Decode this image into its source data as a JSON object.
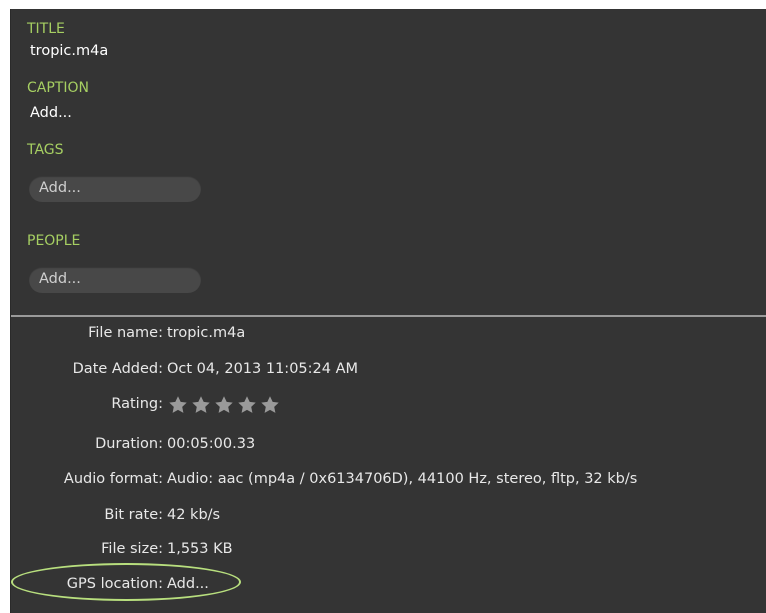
{
  "title_section": {
    "label": "TITLE",
    "value": "tropic.m4a"
  },
  "caption_section": {
    "label": "CAPTION",
    "value": "Add..."
  },
  "tags_section": {
    "label": "TAGS",
    "placeholder": "Add..."
  },
  "people_section": {
    "label": "PEOPLE",
    "placeholder": "Add..."
  },
  "properties": {
    "file_name": {
      "key": "File name:",
      "value": "tropic.m4a"
    },
    "date_added": {
      "key": "Date Added:",
      "value": "Oct 04, 2013 11:05:24 AM"
    },
    "rating": {
      "key": "Rating:",
      "stars_total": 5,
      "stars_filled": 0
    },
    "duration": {
      "key": "Duration:",
      "value": "00:05:00.33"
    },
    "audio_format": {
      "key": "Audio format:",
      "value": "Audio: aac (mp4a / 0x6134706D), 44100 Hz, stereo, fltp, 32 kb/s"
    },
    "bit_rate": {
      "key": "Bit rate:",
      "value": "42 kb/s"
    },
    "file_size": {
      "key": "File size:",
      "value": "1,553 KB"
    },
    "gps_location": {
      "key": "GPS location:",
      "value": "Add..."
    }
  },
  "colors": {
    "panel_bg": "#343434",
    "label_green": "#a6cf62",
    "highlight_ellipse": "#b8df7e",
    "star_gray": "#9a9a9a"
  },
  "icons": {
    "rating_star": "star-icon"
  }
}
